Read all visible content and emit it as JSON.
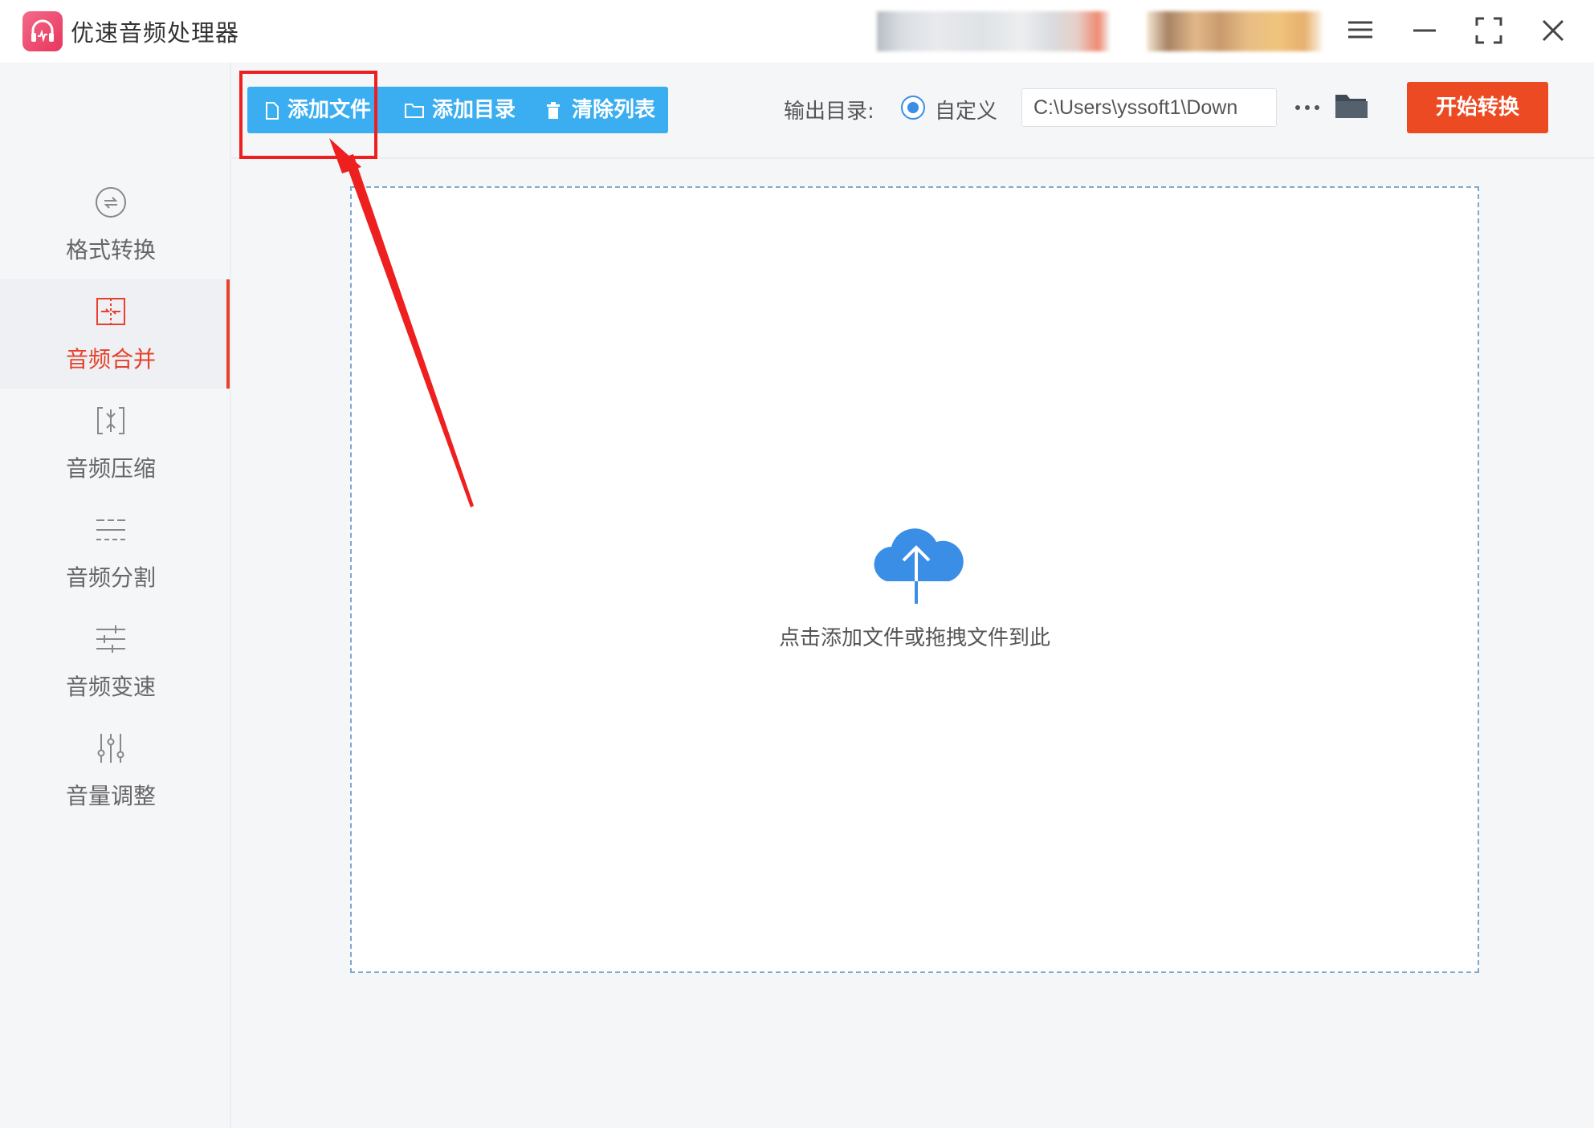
{
  "app": {
    "title": "优速音频处理器",
    "accent_color": "#e7402b",
    "primary_color": "#3aaef0"
  },
  "window_controls": [
    "menu-icon",
    "minimize-icon",
    "maximize-icon",
    "close-icon"
  ],
  "sidebar": {
    "items": [
      {
        "label": "格式转换",
        "icon": "format-convert-icon",
        "active": false
      },
      {
        "label": "音频合并",
        "icon": "merge-icon",
        "active": true
      },
      {
        "label": "音频压缩",
        "icon": "compress-icon",
        "active": false
      },
      {
        "label": "音频分割",
        "icon": "split-icon",
        "active": false
      },
      {
        "label": "音频变速",
        "icon": "speed-icon",
        "active": false
      },
      {
        "label": "音量调整",
        "icon": "volume-icon",
        "active": false
      }
    ]
  },
  "toolbar": {
    "add_file": "添加文件",
    "add_folder": "添加目录",
    "clear_list": "清除列表",
    "output_label": "输出目录:",
    "custom_option": "自定义",
    "output_path": "C:\\Users\\yssoft1\\Down",
    "start_button": "开始转换"
  },
  "dropzone": {
    "hint": "点击添加文件或拖拽文件到此",
    "icon": "cloud-upload-icon"
  }
}
